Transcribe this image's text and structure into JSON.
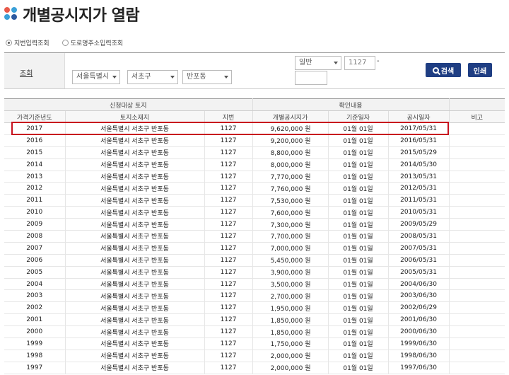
{
  "page": {
    "title": "개별공시지가 열람"
  },
  "search_mode": {
    "options": [
      {
        "label": "지번입력조회",
        "selected": true
      },
      {
        "label": "도로명주소입력조회",
        "selected": false
      }
    ]
  },
  "search": {
    "label": "조회",
    "city": "서울특별시",
    "district": "서초구",
    "dong": "반포동",
    "land_type": "일반",
    "main_lot": "1127",
    "lot_separator": "-",
    "sub_lot": "",
    "search_button": "검색",
    "print_button": "인쇄"
  },
  "table": {
    "group_headers": [
      "신청대상 토지",
      "확인내용"
    ],
    "columns": [
      "가격기준년도",
      "토지소재지",
      "지번",
      "개별공시지가",
      "기준일자",
      "공시일자",
      "비고"
    ],
    "rows": [
      {
        "year": "2017",
        "location": "서울특별시 서초구 반포동",
        "lot": "1127",
        "price": "9,620,000 원",
        "base_date": "01월 01일",
        "pub_date": "2017/05/31",
        "note": ""
      },
      {
        "year": "2016",
        "location": "서울특별시 서초구 반포동",
        "lot": "1127",
        "price": "9,200,000 원",
        "base_date": "01월 01일",
        "pub_date": "2016/05/31",
        "note": ""
      },
      {
        "year": "2015",
        "location": "서울특별시 서초구 반포동",
        "lot": "1127",
        "price": "8,800,000 원",
        "base_date": "01월 01일",
        "pub_date": "2015/05/29",
        "note": ""
      },
      {
        "year": "2014",
        "location": "서울특별시 서초구 반포동",
        "lot": "1127",
        "price": "8,000,000 원",
        "base_date": "01월 01일",
        "pub_date": "2014/05/30",
        "note": ""
      },
      {
        "year": "2013",
        "location": "서울특별시 서초구 반포동",
        "lot": "1127",
        "price": "7,770,000 원",
        "base_date": "01월 01일",
        "pub_date": "2013/05/31",
        "note": ""
      },
      {
        "year": "2012",
        "location": "서울특별시 서초구 반포동",
        "lot": "1127",
        "price": "7,760,000 원",
        "base_date": "01월 01일",
        "pub_date": "2012/05/31",
        "note": ""
      },
      {
        "year": "2011",
        "location": "서울특별시 서초구 반포동",
        "lot": "1127",
        "price": "7,530,000 원",
        "base_date": "01월 01일",
        "pub_date": "2011/05/31",
        "note": ""
      },
      {
        "year": "2010",
        "location": "서울특별시 서초구 반포동",
        "lot": "1127",
        "price": "7,600,000 원",
        "base_date": "01월 01일",
        "pub_date": "2010/05/31",
        "note": ""
      },
      {
        "year": "2009",
        "location": "서울특별시 서초구 반포동",
        "lot": "1127",
        "price": "7,300,000 원",
        "base_date": "01월 01일",
        "pub_date": "2009/05/29",
        "note": ""
      },
      {
        "year": "2008",
        "location": "서울특별시 서초구 반포동",
        "lot": "1127",
        "price": "7,700,000 원",
        "base_date": "01월 01일",
        "pub_date": "2008/05/31",
        "note": ""
      },
      {
        "year": "2007",
        "location": "서울특별시 서초구 반포동",
        "lot": "1127",
        "price": "7,000,000 원",
        "base_date": "01월 01일",
        "pub_date": "2007/05/31",
        "note": ""
      },
      {
        "year": "2006",
        "location": "서울특별시 서초구 반포동",
        "lot": "1127",
        "price": "5,450,000 원",
        "base_date": "01월 01일",
        "pub_date": "2006/05/31",
        "note": ""
      },
      {
        "year": "2005",
        "location": "서울특별시 서초구 반포동",
        "lot": "1127",
        "price": "3,900,000 원",
        "base_date": "01월 01일",
        "pub_date": "2005/05/31",
        "note": ""
      },
      {
        "year": "2004",
        "location": "서울특별시 서초구 반포동",
        "lot": "1127",
        "price": "3,500,000 원",
        "base_date": "01월 01일",
        "pub_date": "2004/06/30",
        "note": ""
      },
      {
        "year": "2003",
        "location": "서울특별시 서초구 반포동",
        "lot": "1127",
        "price": "2,700,000 원",
        "base_date": "01월 01일",
        "pub_date": "2003/06/30",
        "note": ""
      },
      {
        "year": "2002",
        "location": "서울특별시 서초구 반포동",
        "lot": "1127",
        "price": "1,950,000 원",
        "base_date": "01월 01일",
        "pub_date": "2002/06/29",
        "note": ""
      },
      {
        "year": "2001",
        "location": "서울특별시 서초구 반포동",
        "lot": "1127",
        "price": "1,850,000 원",
        "base_date": "01월 01일",
        "pub_date": "2001/06/30",
        "note": ""
      },
      {
        "year": "2000",
        "location": "서울특별시 서초구 반포동",
        "lot": "1127",
        "price": "1,850,000 원",
        "base_date": "01월 01일",
        "pub_date": "2000/06/30",
        "note": ""
      },
      {
        "year": "1999",
        "location": "서울특별시 서초구 반포동",
        "lot": "1127",
        "price": "1,750,000 원",
        "base_date": "01월 01일",
        "pub_date": "1999/06/30",
        "note": ""
      },
      {
        "year": "1998",
        "location": "서울특별시 서초구 반포동",
        "lot": "1127",
        "price": "2,000,000 원",
        "base_date": "01월 01일",
        "pub_date": "1998/06/30",
        "note": ""
      },
      {
        "year": "1997",
        "location": "서울특별시 서초구 반포동",
        "lot": "1127",
        "price": "2,000,000 원",
        "base_date": "01월 01일",
        "pub_date": "1997/06/30",
        "note": ""
      }
    ]
  },
  "colors": {
    "button": "#1f3e83",
    "highlight": "#c8101e",
    "header_bg": "#f2f2f2"
  }
}
